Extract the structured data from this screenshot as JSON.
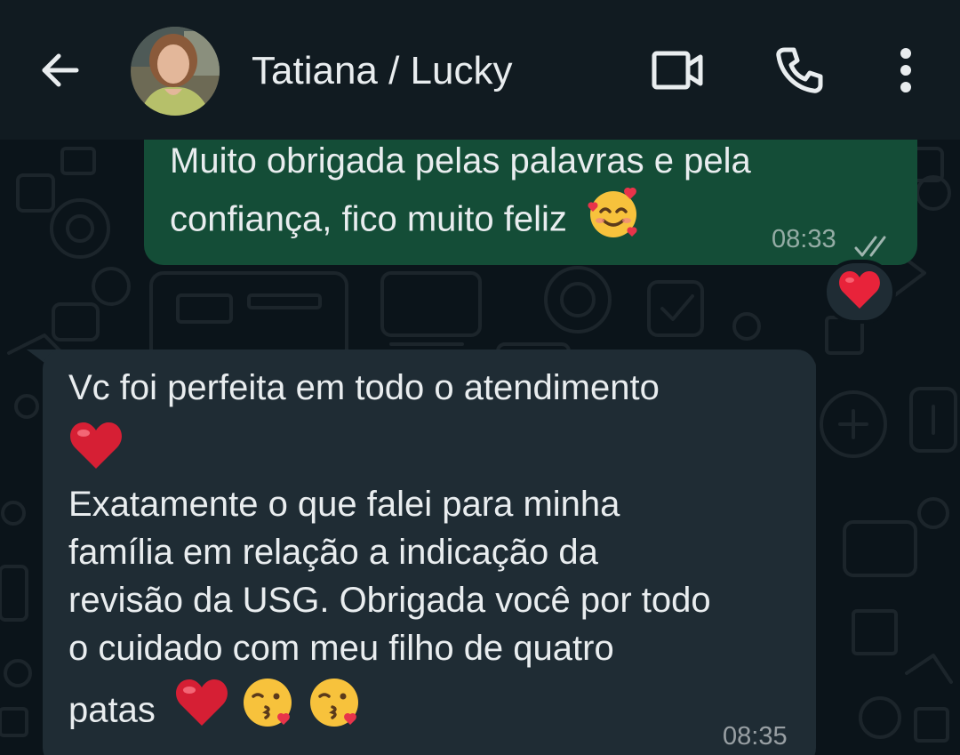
{
  "header": {
    "contact_name": "Tatiana / Lucky",
    "icons": {
      "back": "arrow-back-icon",
      "video": "video-call-icon",
      "call": "voice-call-icon",
      "menu": "more-vert-icon"
    }
  },
  "messages": [
    {
      "direction": "outgoing",
      "lines": [
        "Muito obrigada pelas palavras e pela",
        "confiança, fico muito feliz"
      ],
      "trailing_emoji": "smiling-face-with-hearts",
      "time": "08:33",
      "status": "read-double-check",
      "reaction": "red-heart"
    },
    {
      "direction": "incoming",
      "lines": [
        "Vc foi perfeita em todo o atendimento",
        "Exatamente o que falei para minha",
        "família em relação a indicação da",
        "revisão da USG. Obrigada você por todo",
        "o cuidado com meu filho de quatro",
        "patas"
      ],
      "emojis": [
        "red-heart",
        "red-heart",
        "face-blowing-a-kiss",
        "face-blowing-a-kiss"
      ],
      "time": "08:35"
    }
  ],
  "colors": {
    "background": "#0b141a",
    "header": "#111b21",
    "outgoing_bubble": "#144d37",
    "incoming_bubble": "#1f2c34",
    "text": "#e9edef"
  }
}
